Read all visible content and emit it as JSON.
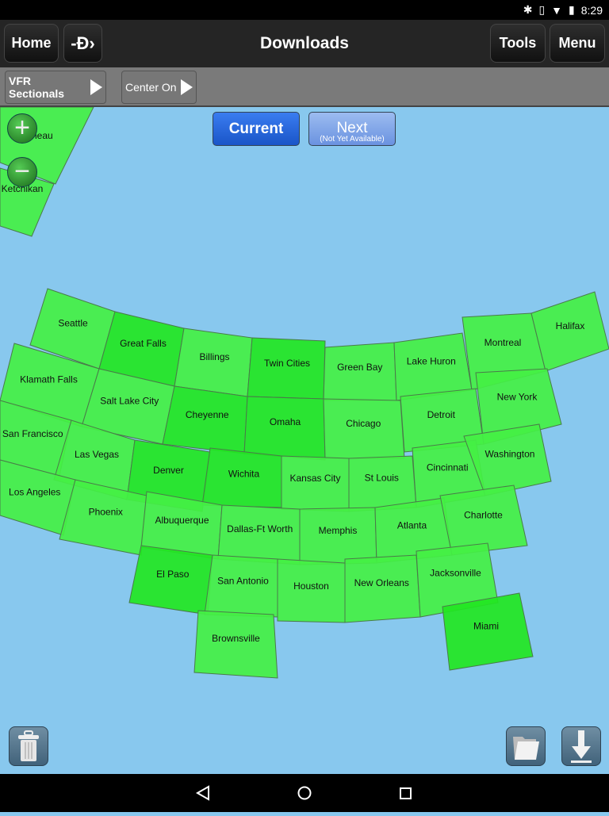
{
  "status": {
    "time": "8:29"
  },
  "header": {
    "title": "Downloads",
    "home": "Home",
    "tools": "Tools",
    "menu": "Menu",
    "route_icon": "route-arrow-icon"
  },
  "subbar": {
    "chart_type": "VFR Sectionals",
    "center_on": "Center On"
  },
  "cycle": {
    "current": "Current",
    "next": "Next",
    "next_note": "(Not Yet Available)"
  },
  "colors": {
    "ocean": "#88c8ee",
    "tile": "#44f044",
    "tile_selected": "#22e622",
    "active_button": "#1a5fd6"
  },
  "charts": [
    "Juneau",
    "Ketchikan",
    "Seattle",
    "Great Falls",
    "Billings",
    "Twin Cities",
    "Green Bay",
    "Lake Huron",
    "Montreal",
    "Halifax",
    "Klamath Falls",
    "Salt Lake City",
    "Cheyenne",
    "Omaha",
    "Chicago",
    "Detroit",
    "New York",
    "San Francisco",
    "Las Vegas",
    "Denver",
    "Wichita",
    "Kansas City",
    "St Louis",
    "Cincinnati",
    "Washington",
    "Los Angeles",
    "Phoenix",
    "Albuquerque",
    "Dallas-Ft Worth",
    "Memphis",
    "Atlanta",
    "Charlotte",
    "El Paso",
    "San Antonio",
    "Houston",
    "New Orleans",
    "Jacksonville",
    "Miami",
    "Brownsville"
  ],
  "bottom": {
    "delete_icon": "trash-icon",
    "folder_icon": "folder-icon",
    "download_icon": "download-icon"
  }
}
